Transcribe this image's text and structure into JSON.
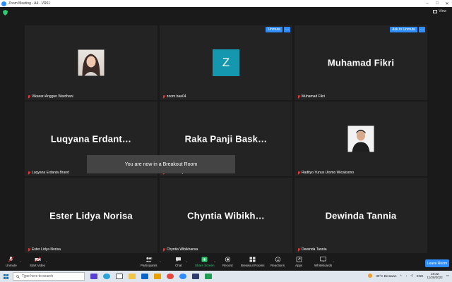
{
  "titlebar": {
    "title": "Zoom Meeting - A4 - VR61",
    "minimize": "–",
    "maximize": "□",
    "close": "✕"
  },
  "view": {
    "label": "View"
  },
  "tiles": [
    {
      "id": "t1",
      "label": "Vikasari Anggun Wardhani",
      "muted": true,
      "kind": "photo-woman"
    },
    {
      "id": "t2",
      "label": "zoom baa04",
      "muted": true,
      "kind": "avatar",
      "avatar_letter": "Z",
      "btn_label": "Unmute",
      "more": "···"
    },
    {
      "id": "t3",
      "label": "Muhamad Fikri",
      "muted": true,
      "kind": "name",
      "big_name": "Muhamad Fikri",
      "btn_label": "Ask to Unmute",
      "more": "···"
    },
    {
      "id": "t4",
      "label": "Luqyana Erdanta Brand",
      "muted": true,
      "kind": "name",
      "big_name": "Luqyana  Erdant…"
    },
    {
      "id": "t5",
      "label": "Raka Panji Baskara",
      "muted": true,
      "kind": "name",
      "big_name": "Raka  Panji  Bask…"
    },
    {
      "id": "t6",
      "label": "Radityo Yunus Utomo Wicaksono",
      "muted": true,
      "kind": "photo-man"
    },
    {
      "id": "t7",
      "label": "Ester Lidya Norisa",
      "muted": true,
      "kind": "name",
      "big_name": "Ester  Lidya  Norisa"
    },
    {
      "id": "t8",
      "label": "Chyntia Wibikhansa",
      "muted": true,
      "kind": "name",
      "big_name": "Chyntia  Wibikh…"
    },
    {
      "id": "t9",
      "label": "Dewinda Tannia",
      "muted": true,
      "kind": "name",
      "big_name": "Dewinda  Tannia"
    }
  ],
  "toast": "You are now in a Breakout Room",
  "toolbar": {
    "unmute": "Unmute",
    "start_video": "Start Video",
    "participants": "Participants",
    "participants_count": "8",
    "chat": "Chat",
    "share_screen": "Share Screen",
    "record": "Record",
    "breakout_rooms": "Breakout Rooms",
    "reactions": "Reactions",
    "apps": "Apps",
    "whiteboards": "Whiteboards",
    "caret": "^",
    "leave": "Leave Room"
  },
  "taskbar": {
    "search_placeholder": "Type here to search",
    "weather": "30°C  Berawan",
    "time": "18:32",
    "date": "11/28/2022",
    "lang": "ENG"
  },
  "colors": {
    "accent": "#2d8cff",
    "green": "#2ecc71",
    "avatar": "#1597b0"
  }
}
